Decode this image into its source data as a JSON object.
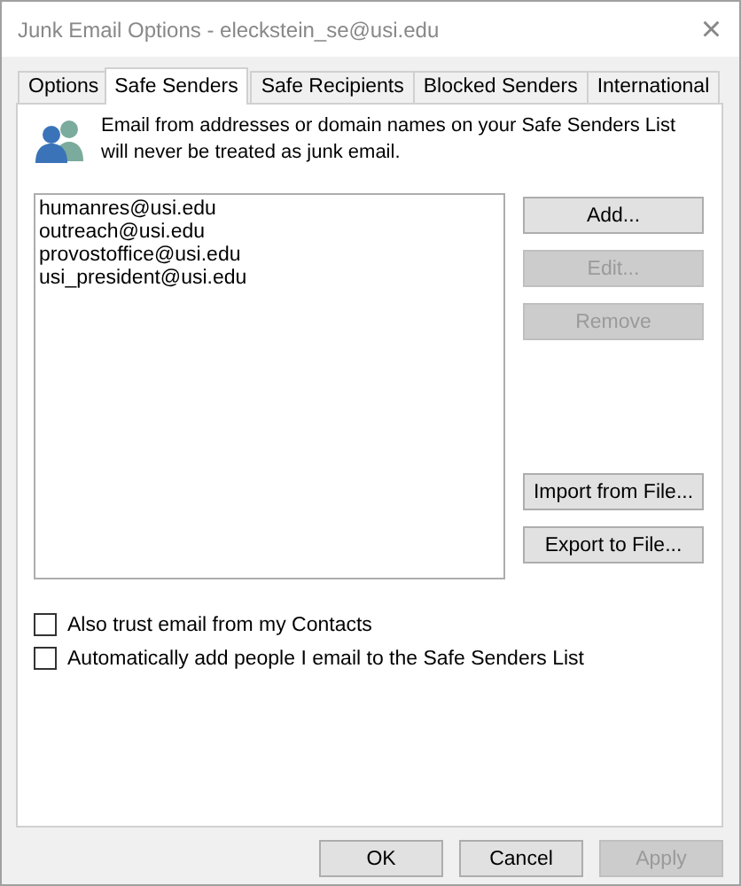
{
  "window": {
    "title": "Junk Email Options - eleckstein_se@usi.edu",
    "close": "×"
  },
  "tabs": [
    {
      "label": "Options",
      "selected": false
    },
    {
      "label": "Safe Senders",
      "selected": true
    },
    {
      "label": "Safe Recipients",
      "selected": false
    },
    {
      "label": "Blocked Senders",
      "selected": false
    },
    {
      "label": "International",
      "selected": false
    }
  ],
  "info_text": "Email from addresses or domain names on your Safe Senders List will never be treated as junk email.",
  "senders": [
    "humanres@usi.edu",
    "outreach@usi.edu",
    "provostoffice@usi.edu",
    "usi_president@usi.edu"
  ],
  "side_buttons": [
    {
      "label": "Add...",
      "disabled": false
    },
    {
      "label": "Edit...",
      "disabled": true
    },
    {
      "label": "Remove",
      "disabled": true
    }
  ],
  "file_buttons": [
    {
      "label": "Import from File...",
      "disabled": false
    },
    {
      "label": "Export to File...",
      "disabled": false
    }
  ],
  "options": [
    {
      "label": "Also trust email from my Contacts",
      "checked": false
    },
    {
      "label": "Automatically add people I email to the Safe Senders List",
      "checked": false
    }
  ],
  "footer_buttons": [
    {
      "label": "OK",
      "disabled": false
    },
    {
      "label": "Cancel",
      "disabled": false
    },
    {
      "label": "Apply",
      "disabled": true
    }
  ]
}
